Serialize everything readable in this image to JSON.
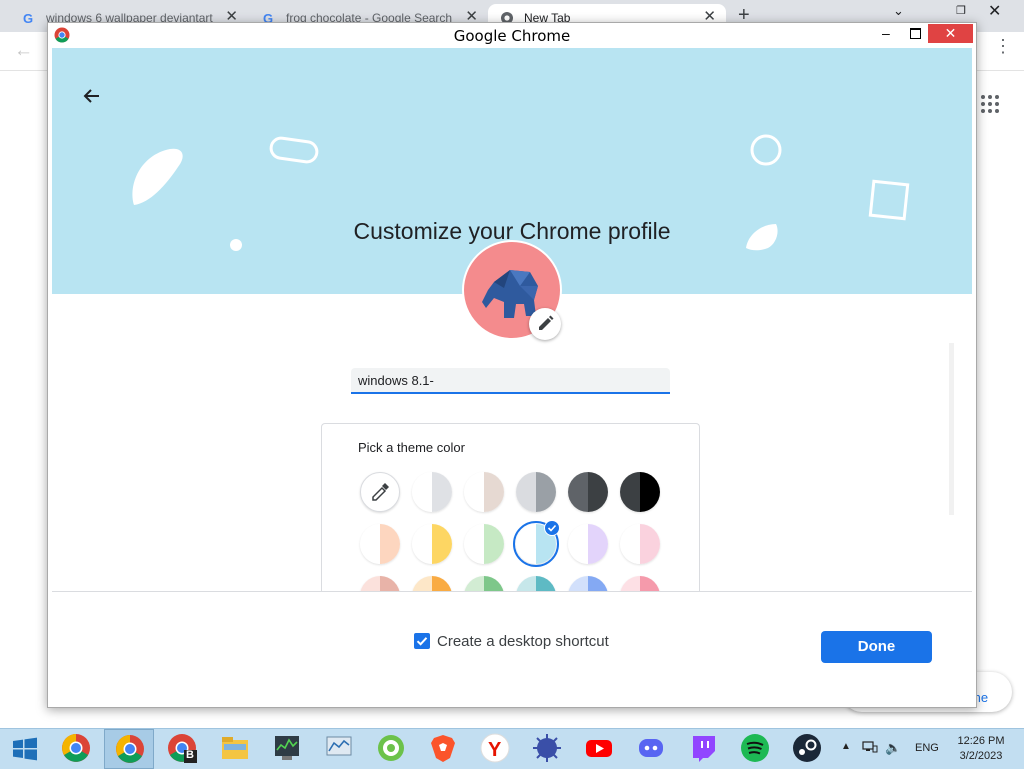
{
  "browser": {
    "tabs": [
      {
        "label": "windows 6 wallpaper deviantart",
        "icon": "google-g-icon",
        "active": false
      },
      {
        "label": "frog chocolate - Google Search",
        "icon": "google-g-icon",
        "active": false
      },
      {
        "label": "New Tab",
        "icon": "chrome-icon",
        "active": true
      }
    ],
    "customize_chip_label": "me"
  },
  "dialog": {
    "window_title": "Google Chrome",
    "headline": "Customize your Chrome profile",
    "name_input_value": "windows 8.1-",
    "theme": {
      "title": "Pick a theme color",
      "swatches": [
        {
          "name": "picker",
          "left": "#ffffff",
          "right": "#ffffff"
        },
        {
          "name": "white",
          "left": "#ffffff",
          "right": "#dfe1e5"
        },
        {
          "name": "warm-grey",
          "left": "#ffffff",
          "right": "#e6d9d2"
        },
        {
          "name": "grey",
          "left": "#dadce0",
          "right": "#9aa0a6"
        },
        {
          "name": "dark-slate",
          "left": "#5f6368",
          "right": "#3c4043"
        },
        {
          "name": "black",
          "left": "#3c4043",
          "right": "#000000"
        },
        {
          "name": "peach",
          "left": "#ffffff",
          "right": "#fdd6bf"
        },
        {
          "name": "yellow",
          "left": "#ffffff",
          "right": "#fdd663"
        },
        {
          "name": "green",
          "left": "#ffffff",
          "right": "#c6e9c4"
        },
        {
          "name": "light-blue",
          "left": "#ffffff",
          "right": "#b8e4f2",
          "selected": true
        },
        {
          "name": "lavender",
          "left": "#ffffff",
          "right": "#e3d4fb"
        },
        {
          "name": "pink",
          "left": "#ffffff",
          "right": "#fad2de"
        },
        {
          "name": "rose",
          "left": "#fbe1dc",
          "right": "#e8b3a8"
        },
        {
          "name": "orange",
          "left": "#fde7c8",
          "right": "#f9ab43"
        },
        {
          "name": "sage",
          "left": "#d2ecd3",
          "right": "#7ec78a"
        },
        {
          "name": "teal",
          "left": "#c6e7ea",
          "right": "#5ebac4"
        },
        {
          "name": "periwinkle",
          "left": "#d2e0fb",
          "right": "#84a9f3"
        },
        {
          "name": "salmon",
          "left": "#fde0e5",
          "right": "#f59aab"
        }
      ]
    },
    "shortcut_label": "Create a desktop shortcut",
    "shortcut_checked": true,
    "done_label": "Done"
  },
  "taskbar": {
    "apps": [
      {
        "name": "chrome-icon",
        "pressed": false
      },
      {
        "name": "chrome-icon",
        "pressed": true
      },
      {
        "name": "chrome-profile-b-icon",
        "pressed": false,
        "badge": "B"
      },
      {
        "name": "file-explorer-icon",
        "pressed": false
      },
      {
        "name": "task-manager-icon",
        "pressed": false
      },
      {
        "name": "resource-monitor-icon",
        "pressed": false
      },
      {
        "name": "greenshot-icon",
        "pressed": false
      },
      {
        "name": "brave-icon",
        "pressed": false
      },
      {
        "name": "yandex-icon",
        "pressed": false
      },
      {
        "name": "bug-icon",
        "pressed": false
      },
      {
        "name": "youtube-icon",
        "pressed": false
      },
      {
        "name": "discord-icon",
        "pressed": false
      },
      {
        "name": "twitch-icon",
        "pressed": false
      },
      {
        "name": "spotify-icon",
        "pressed": false
      },
      {
        "name": "steam-icon",
        "pressed": false
      }
    ],
    "language": "ENG",
    "time": "12:26 PM",
    "date": "3/2/2023"
  }
}
